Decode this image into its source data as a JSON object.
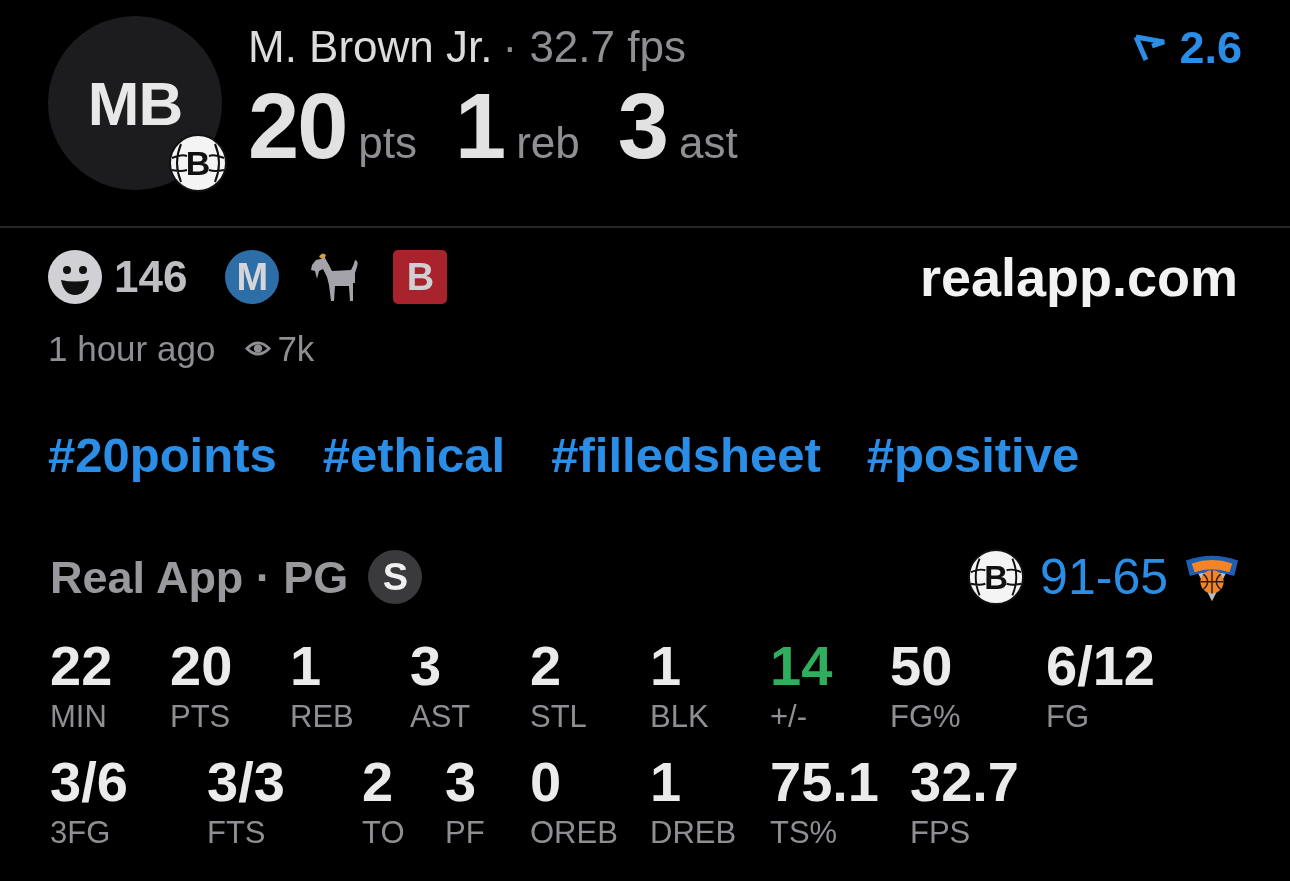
{
  "player": {
    "initials": "MB",
    "team_logo_letter": "B",
    "name": "M. Brown Jr.",
    "meta": "· 32.7 fps"
  },
  "headline_stats": [
    {
      "value": "20",
      "unit": "pts"
    },
    {
      "value": "1",
      "unit": "reb"
    },
    {
      "value": "3",
      "unit": "ast"
    }
  ],
  "rating": {
    "value": "2.6"
  },
  "reactions": {
    "count": "146",
    "badges": [
      {
        "kind": "circle",
        "label": "M"
      },
      {
        "kind": "goat"
      },
      {
        "kind": "square",
        "label": "B"
      }
    ]
  },
  "site": "realapp.com",
  "post": {
    "time": "1 hour ago",
    "views": "7k"
  },
  "hashtags": [
    "#20points",
    "#ethical",
    "#filledsheet",
    "#positive"
  ],
  "game": {
    "title": "Real App · PG",
    "role_badge": "S",
    "home_logo_letter": "B",
    "score": "91-65"
  },
  "stat_rows": [
    [
      {
        "value": "22",
        "label": "MIN",
        "color": "#ebebeb"
      },
      {
        "value": "20",
        "label": "PTS",
        "color": "#ebebeb"
      },
      {
        "value": "1",
        "label": "REB",
        "color": "#ebebeb"
      },
      {
        "value": "3",
        "label": "AST",
        "color": "#ebebeb"
      },
      {
        "value": "2",
        "label": "STL",
        "color": "#ebebeb"
      },
      {
        "value": "1",
        "label": "BLK",
        "color": "#ebebeb"
      },
      {
        "value": "14",
        "label": "+/-",
        "color": "#2fae5e"
      },
      {
        "value": "50",
        "label": "FG%",
        "color": "#ebebeb"
      },
      {
        "value": "6/12",
        "label": "FG",
        "color": "#ebebeb"
      }
    ],
    [
      {
        "value": "3/6",
        "label": "3FG",
        "color": "#ebebeb"
      },
      {
        "value": "3/3",
        "label": "FTS",
        "color": "#ebebeb"
      },
      {
        "value": "2",
        "label": "TO",
        "color": "#ebebeb"
      },
      {
        "value": "3",
        "label": "PF",
        "color": "#ebebeb"
      },
      {
        "value": "0",
        "label": "OREB",
        "color": "#ebebeb"
      },
      {
        "value": "1",
        "label": "DREB",
        "color": "#ebebeb"
      },
      {
        "value": "75.1",
        "label": "TS%",
        "color": "#ebebeb"
      },
      {
        "value": "32.7",
        "label": "FPS",
        "color": "#ebebeb"
      }
    ]
  ]
}
